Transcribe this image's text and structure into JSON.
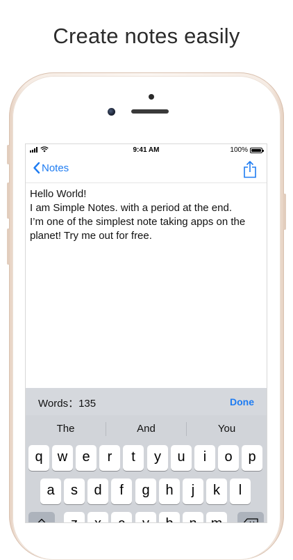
{
  "headline": "Create notes easily",
  "status": {
    "time": "9:41 AM",
    "battery": "100%"
  },
  "nav": {
    "back_label": "Notes"
  },
  "note": {
    "lines": [
      "Hello World!",
      "I am Simple Notes. with a period at the end.",
      "I’m one of the simplest note taking apps on the",
      "planet! Try me out for free."
    ]
  },
  "toolbar": {
    "word_count": "Words：135",
    "done_label": "Done"
  },
  "keyboard": {
    "suggestions": [
      "The",
      "And",
      "You"
    ],
    "row1": [
      "q",
      "w",
      "e",
      "r",
      "t",
      "y",
      "u",
      "i",
      "o",
      "p"
    ],
    "row2": [
      "a",
      "s",
      "d",
      "f",
      "g",
      "h",
      "j",
      "k",
      "l"
    ],
    "row3": [
      "z",
      "x",
      "c",
      "v",
      "b",
      "n",
      "m"
    ]
  }
}
